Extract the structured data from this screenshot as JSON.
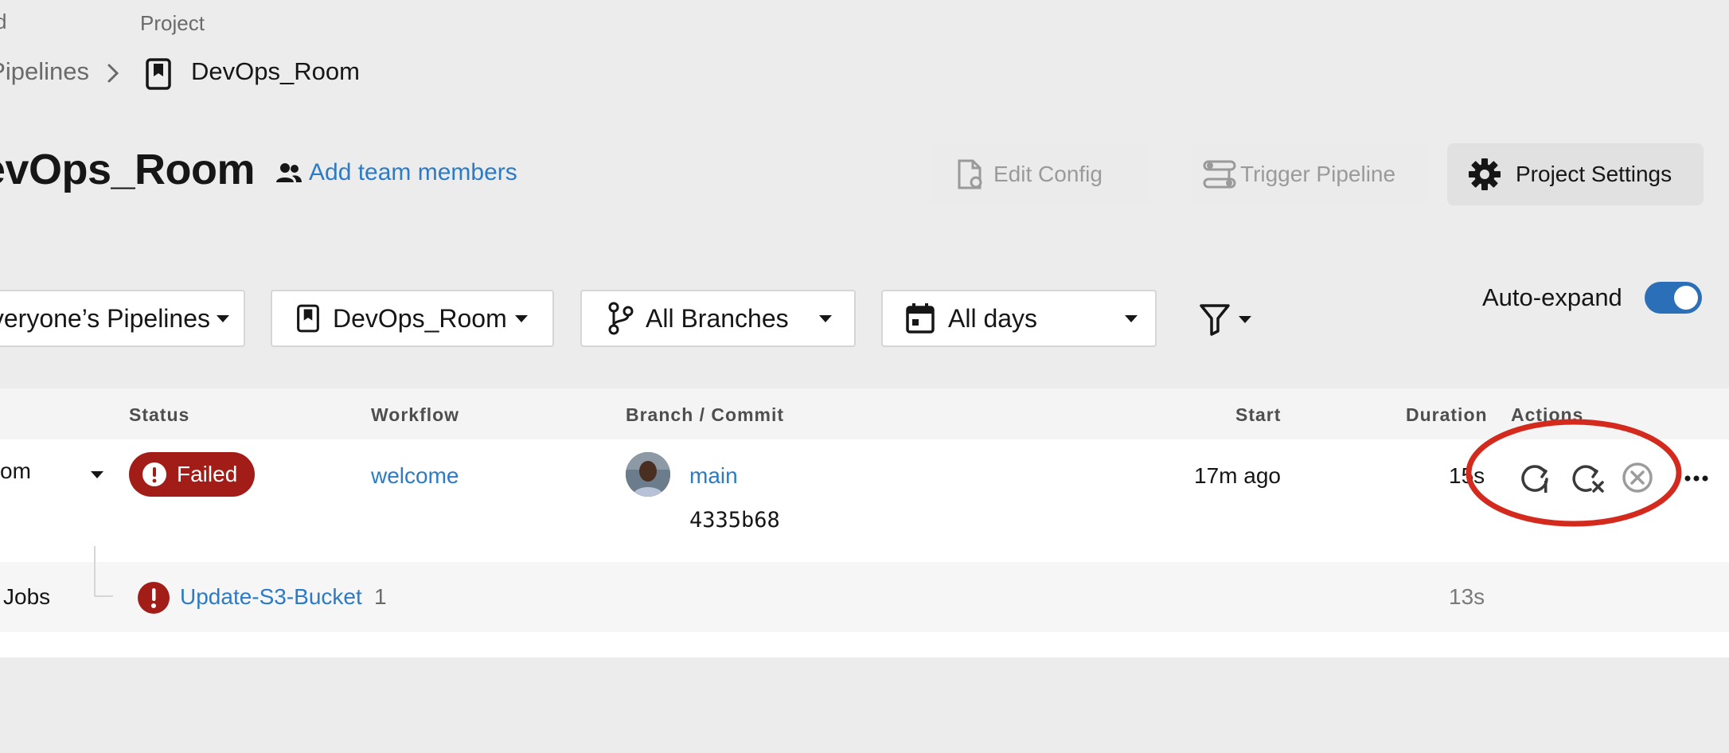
{
  "breadcrumb": {
    "top_partial": "d",
    "project_label": "Project",
    "parent_link": "Pipelines",
    "current": "DevOps_Room"
  },
  "header": {
    "title": "DevOps_Room",
    "add_members": "Add team members",
    "edit_config": "Edit Config",
    "trigger_pipeline": "Trigger Pipeline",
    "project_settings": "Project Settings"
  },
  "filters": {
    "pipelines": "Everyone’s Pipelines",
    "project": "DevOps_Room",
    "branches": "All Branches",
    "days": "All days",
    "auto_expand_label": "Auto-expand",
    "auto_expand_on": true
  },
  "table": {
    "headers": {
      "status": "Status",
      "workflow": "Workflow",
      "branch_commit": "Branch / Commit",
      "start": "Start",
      "duration": "Duration",
      "actions": "Actions"
    },
    "row": {
      "pipeline_partial": "om",
      "status": "Failed",
      "workflow": "welcome",
      "branch": "main",
      "commit": "4335b68",
      "start": "17m ago",
      "duration": "15s"
    },
    "jobs": {
      "label": "Jobs",
      "job_name": "Update-S3-Bucket",
      "job_number": "1",
      "duration": "13s"
    }
  },
  "colors": {
    "accent": "#2b7bc6",
    "failed": "#a21d18",
    "highlight_ring": "#d42a1e",
    "toggle": "#2b6fb8"
  },
  "icons": [
    "chevron-right-icon",
    "project-icon",
    "people-icon",
    "edit-config-icon",
    "trigger-pipeline-icon",
    "gear-icon",
    "branch-icon",
    "calendar-icon",
    "filter-icon",
    "alert-icon",
    "rerun-icon",
    "rerun-failed-icon",
    "cancel-icon",
    "more-icon"
  ]
}
